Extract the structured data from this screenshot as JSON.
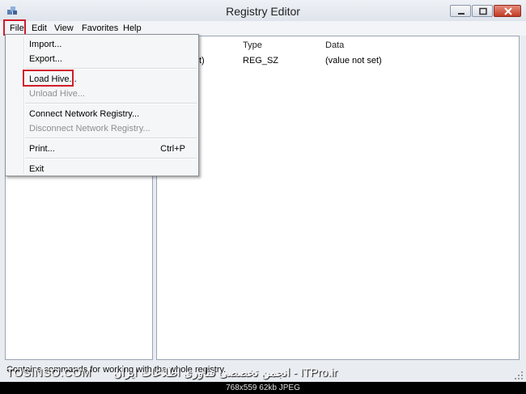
{
  "window": {
    "title": "Registry Editor"
  },
  "menubar": {
    "items": [
      "File",
      "Edit",
      "View",
      "Favorites",
      "Help"
    ]
  },
  "file_menu": {
    "import": "Import...",
    "export": "Export...",
    "load_hive": "Load Hive...",
    "unload_hive": "Unload Hive...",
    "connect": "Connect Network Registry...",
    "disconnect": "Disconnect Network Registry...",
    "print": "Print...",
    "print_shortcut": "Ctrl+P",
    "exit": "Exit"
  },
  "values_table": {
    "columns": [
      "Type",
      "Data"
    ],
    "rows": [
      {
        "name_fragment": "t)",
        "type": "REG_SZ",
        "data": "(value not set)"
      }
    ]
  },
  "statusbar": {
    "text": "Contains commands for working with the whole registry."
  },
  "watermark": {
    "left": "TOSINSO.COM",
    "right": "انجمن تخصصی فناوری اطلاعات ایران - ITPro.ir",
    "info": "768x559  62kb  JPEG"
  },
  "colors": {
    "highlight": "#d01c2c",
    "close_button": "#c33a23"
  },
  "icons": [
    "registry-editor-icon",
    "minimize-icon",
    "maximize-icon",
    "close-icon",
    "size-grip-icon"
  ]
}
